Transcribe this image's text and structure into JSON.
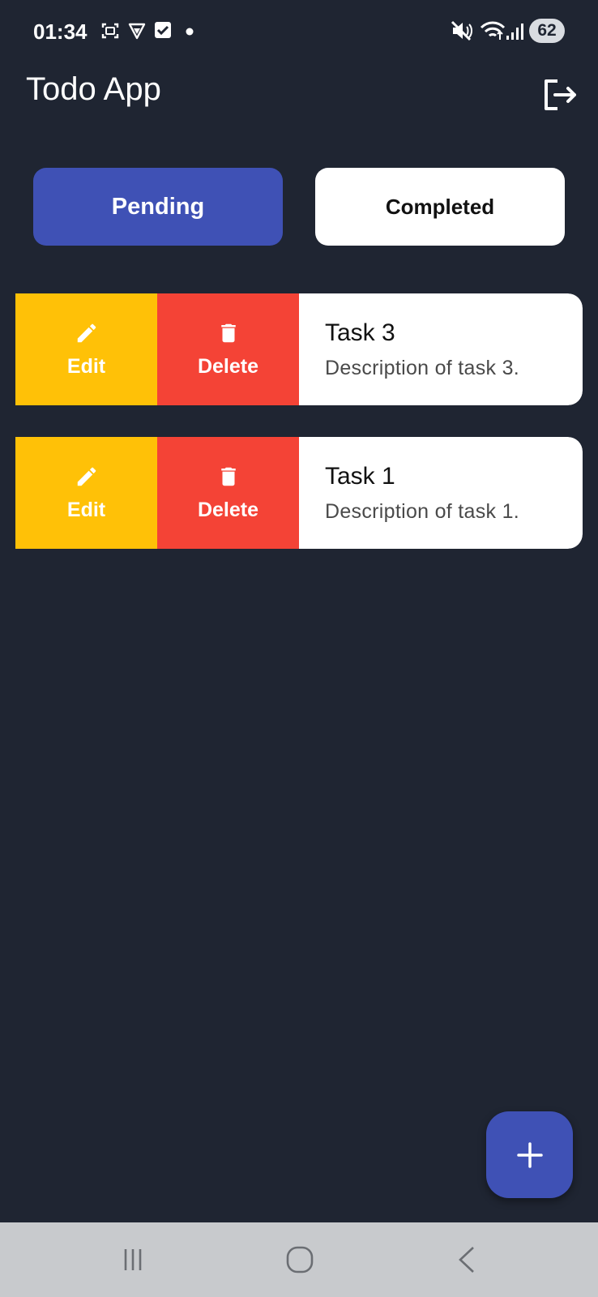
{
  "status_bar": {
    "time": "01:34",
    "battery": "62",
    "icons": [
      "screenshot-icon",
      "vpn-shield-icon",
      "checkbox-notification-icon",
      "dot-icon",
      "mute-icon",
      "wifi-icon",
      "signal-icon"
    ]
  },
  "app": {
    "title": "Todo App",
    "logout_icon": "logout-icon"
  },
  "tabs": [
    {
      "label": "Pending",
      "selected": true
    },
    {
      "label": "Completed",
      "selected": false
    }
  ],
  "actions": {
    "edit_label": "Edit",
    "delete_label": "Delete"
  },
  "tasks": [
    {
      "title": "Task 3",
      "description": "Description of task 3."
    },
    {
      "title": "Task 1",
      "description": "Description of task 1."
    }
  ],
  "colors": {
    "background": "#1f2532",
    "accent": "#3f51b5",
    "edit": "#ffc107",
    "delete": "#f44336"
  }
}
